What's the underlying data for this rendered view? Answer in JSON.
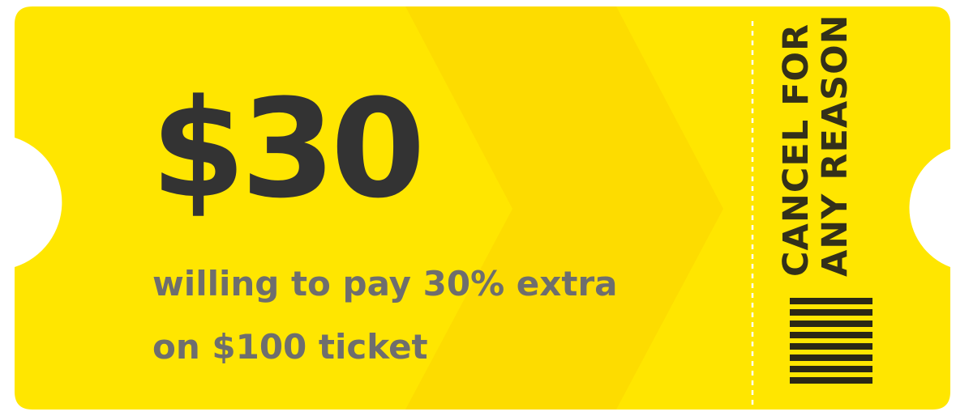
{
  "ticket": {
    "price": "$30",
    "caption_line1": "willing to pay 30% extra",
    "caption_line2": "on $100 ticket",
    "stub_line1": "CANCEL FOR",
    "stub_line2": "ANY REASON",
    "colors": {
      "ticket_yellow": "#ffe600",
      "chevron_yellow": "#fddc00",
      "price_text": "#333333",
      "caption_text": "#6e6e6e",
      "stub_text": "#33301a",
      "perforation": "#ffffff"
    }
  }
}
